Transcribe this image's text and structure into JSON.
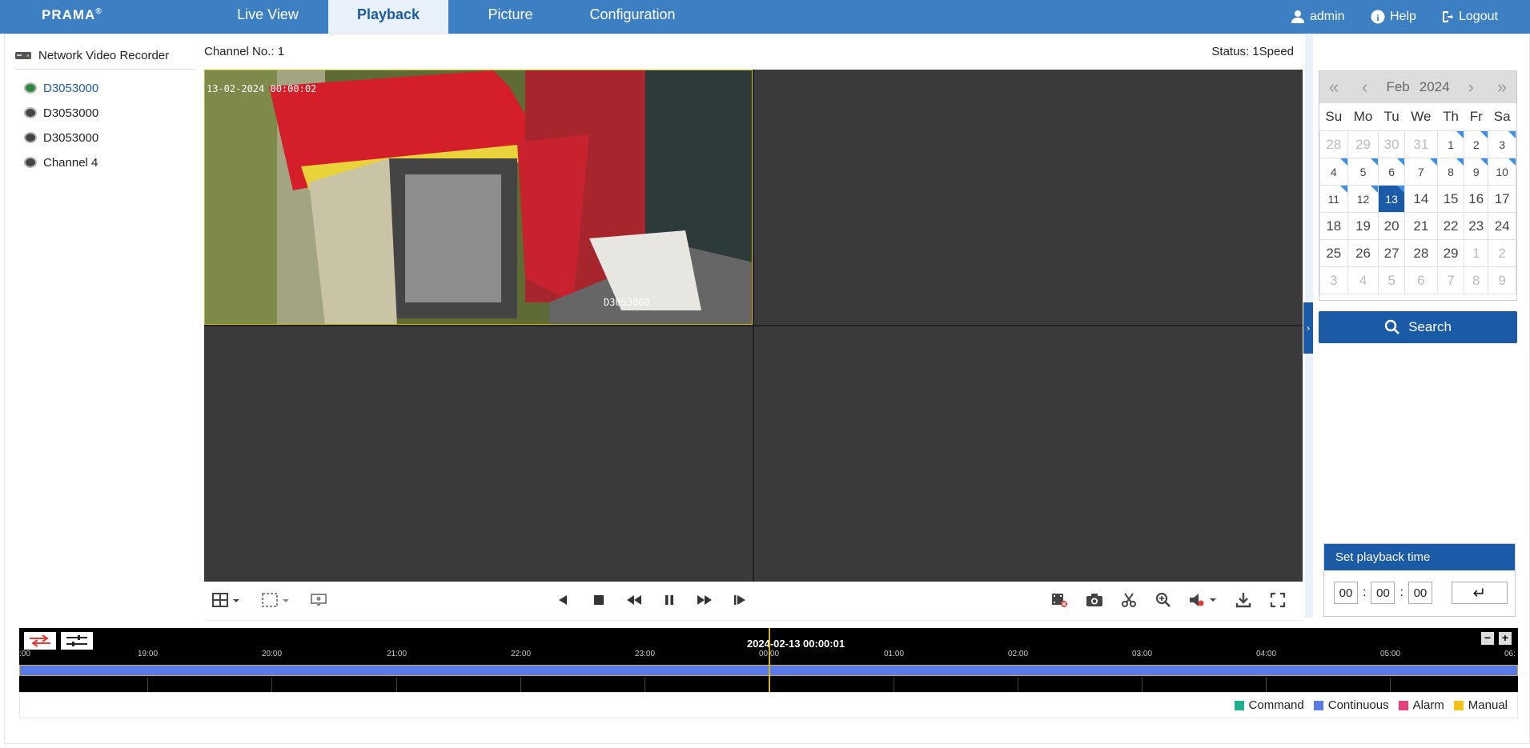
{
  "app": {
    "logo": "PRAMA",
    "logo_mark": "®"
  },
  "nav": {
    "tabs": [
      {
        "label": "Live View"
      },
      {
        "label": "Playback"
      },
      {
        "label": "Picture"
      },
      {
        "label": "Configuration"
      }
    ],
    "active_tab": "Playback",
    "user": "admin",
    "help": "Help",
    "logout": "Logout"
  },
  "tree": {
    "root": "Network Video Recorder",
    "items": [
      {
        "label": "D3053000"
      },
      {
        "label": "D3053000"
      },
      {
        "label": "D3053000"
      },
      {
        "label": "Channel 4"
      }
    ]
  },
  "player": {
    "channel": "Channel No.: 1",
    "status": "Status: 1Speed",
    "osd_time": "13-02-2024 00:00:02",
    "osd_name": "D3053000"
  },
  "calendar": {
    "month": "Feb",
    "year": "2024",
    "weekdays": [
      "Su",
      "Mo",
      "Tu",
      "We",
      "Th",
      "Fr",
      "Sa"
    ],
    "weeks": [
      [
        "28",
        "29",
        "30",
        "31",
        "1",
        "2",
        "3"
      ],
      [
        "4",
        "5",
        "6",
        "7",
        "8",
        "9",
        "10"
      ],
      [
        "11",
        "12",
        "13",
        "14",
        "15",
        "16",
        "17"
      ],
      [
        "18",
        "19",
        "20",
        "21",
        "22",
        "23",
        "24"
      ],
      [
        "25",
        "26",
        "27",
        "28",
        "29",
        "1",
        "2"
      ],
      [
        "3",
        "4",
        "5",
        "6",
        "7",
        "8",
        "9"
      ]
    ],
    "selected_day": "13",
    "search_label": "Search"
  },
  "playback_time": {
    "title": "Set playback time",
    "hh": "00",
    "mm": "00",
    "ss": "00"
  },
  "timeline": {
    "current": "2024-02-13 00:00:01",
    "ticks": [
      ":00",
      "19:00",
      "20:00",
      "21:00",
      "22:00",
      "23:00",
      "00:00",
      "01:00",
      "02:00",
      "03:00",
      "04:00",
      "05:00",
      "06:"
    ]
  },
  "legend": [
    {
      "label": "Command",
      "color": "#1fb08d"
    },
    {
      "label": "Continuous",
      "color": "#5a7ae8"
    },
    {
      "label": "Alarm",
      "color": "#e8407a"
    },
    {
      "label": "Manual",
      "color": "#f2c21b"
    }
  ],
  "colors": {
    "accent": "#3c7fc3",
    "selected": "#1b5aa6"
  }
}
